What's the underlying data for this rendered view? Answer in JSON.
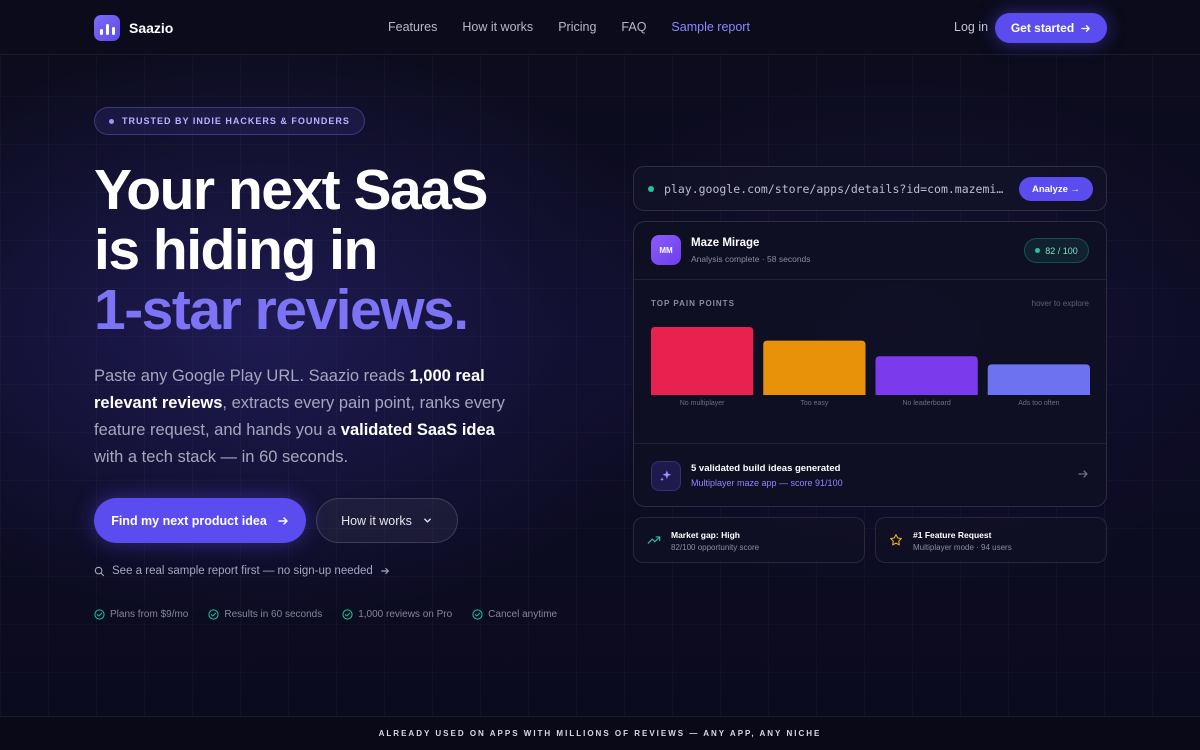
{
  "nav": {
    "brand": "Saazio",
    "links": [
      "Features",
      "How it works",
      "Pricing",
      "FAQ",
      "Sample report"
    ],
    "login": "Log in",
    "cta": "Get started"
  },
  "hero": {
    "badge": "TRUSTED BY INDIE HACKERS & FOUNDERS",
    "headline_line1": "Your next SaaS",
    "headline_line2": "is hiding in",
    "headline_line3": "1-star reviews.",
    "lead_part1": "Paste any Google Play URL. Saazio reads ",
    "lead_bold1": "1,000 real relevant reviews",
    "lead_part2": ", extracts every pain point, ranks every feature request, and hands you a ",
    "lead_bold2": "validated SaaS idea",
    "lead_part3": " with a tech stack — in 60 seconds.",
    "primary_cta": "Find my next product idea",
    "secondary_cta": "How it works",
    "sample_link": "See a real sample report first — no sign-up needed",
    "checks": [
      "Plans from $9/mo",
      "Results in 60 seconds",
      "1,000 reviews on Pro",
      "Cancel anytime"
    ]
  },
  "demo": {
    "url": "play.google.com/store/apps/details?id=com.mazemirage",
    "analyze": "Analyze →",
    "app_initials": "MM",
    "app_name": "Maze Mirage",
    "app_sub": "Analysis complete · 58 seconds",
    "score": "82 / 100",
    "pain_title": "TOP PAIN POINTS",
    "pain_hint": "hover to explore",
    "ideas_title": "5 validated build ideas generated",
    "ideas_sub": "Multiplayer maze app — score 91/100",
    "mini1_title": "Market gap: High",
    "mini1_sub": "82/100 opportunity score",
    "mini2_title": "#1 Feature Request",
    "mini2_sub": "Multiplayer mode · 94 users"
  },
  "chart_data": {
    "type": "bar",
    "categories": [
      "No multiplayer",
      "Too easy",
      "No leaderboard",
      "Ads too often"
    ],
    "values": [
      100,
      80,
      57,
      45
    ],
    "colors": [
      "#e8214e",
      "#e8920a",
      "#7c3aed",
      "#6d73f0"
    ],
    "title": "TOP PAIN POINTS"
  },
  "strip": "ALREADY USED ON APPS WITH MILLIONS OF REVIEWS — ANY APP, ANY NICHE",
  "colors": {
    "accent": "#5b4cf0",
    "accent_text": "#7d73f5",
    "success": "#22c49a",
    "background": "#0b0b1e"
  }
}
